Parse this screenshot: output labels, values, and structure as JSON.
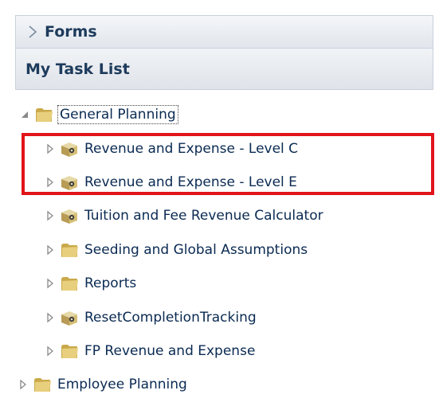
{
  "forms_header": {
    "label": "Forms"
  },
  "tasklist_header": {
    "label": "My Task List"
  },
  "tree": [
    {
      "label": "General Planning",
      "icon": "folder-icon",
      "expanded": true,
      "level": 0
    },
    {
      "label": "Revenue and Expense - Level C",
      "icon": "task-box-icon",
      "expanded": false,
      "level": 1
    },
    {
      "label": "Revenue and Expense - Level E",
      "icon": "task-box-icon",
      "expanded": false,
      "level": 1
    },
    {
      "label": "Tuition and Fee Revenue Calculator",
      "icon": "task-box-icon",
      "expanded": false,
      "level": 1
    },
    {
      "label": "Seeding and Global Assumptions",
      "icon": "folder-icon",
      "expanded": false,
      "level": 1
    },
    {
      "label": "Reports",
      "icon": "folder-icon",
      "expanded": false,
      "level": 1
    },
    {
      "label": "ResetCompletionTracking",
      "icon": "task-box-icon",
      "expanded": false,
      "level": 1
    },
    {
      "label": "FP Revenue and Expense",
      "icon": "folder-icon",
      "expanded": false,
      "level": 1
    },
    {
      "label": "Employee Planning",
      "icon": "folder-icon",
      "expanded": false,
      "level": 0
    }
  ],
  "colors": {
    "highlight": "#e1141b",
    "header_text": "#1d3b5c",
    "label_text": "#0a2a52"
  }
}
